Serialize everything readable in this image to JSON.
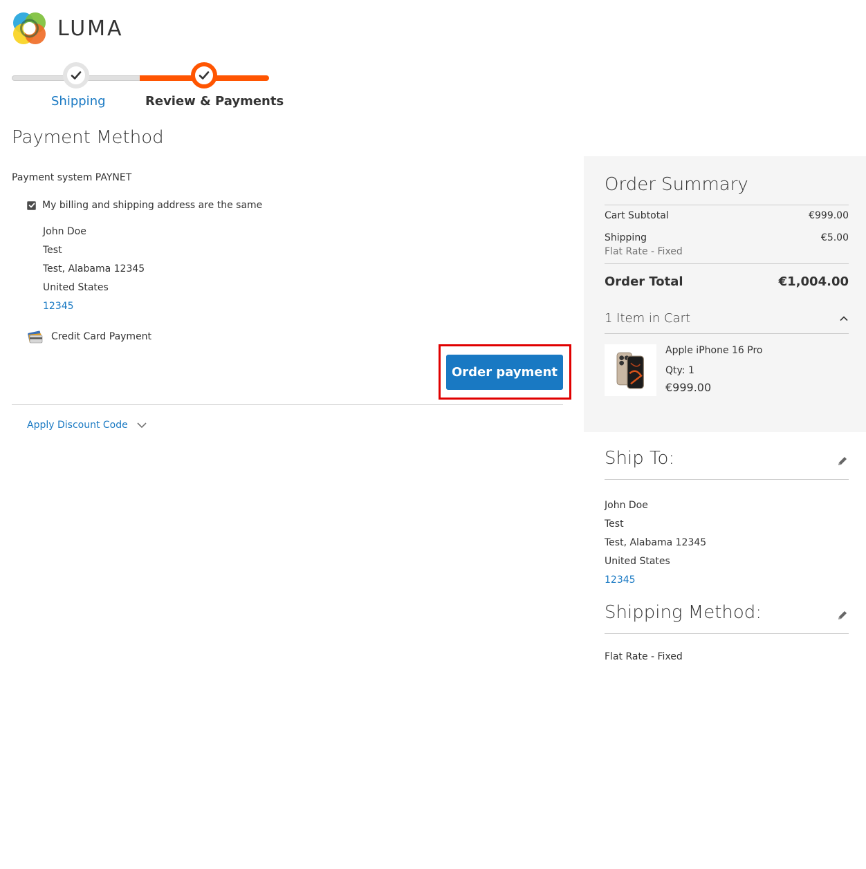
{
  "brand": {
    "name": "LUMA"
  },
  "progress": {
    "steps": [
      {
        "label": "Shipping",
        "state": "complete"
      },
      {
        "label": "Review & Payments",
        "state": "active"
      }
    ]
  },
  "payment": {
    "title": "Payment Method",
    "system_label": "Payment system PAYNET",
    "billing_same_label": "My billing and shipping address are the same",
    "billing_same_checked": true,
    "billing_address": {
      "name": "John Doe",
      "street": "Test",
      "city_line": "Test, Alabama 12345",
      "country": "United States",
      "phone": "12345"
    },
    "method_label": "Credit Card Payment",
    "order_button": "Order payment",
    "discount_label": "Apply Discount Code"
  },
  "summary": {
    "title": "Order Summary",
    "cart_subtotal_label": "Cart Subtotal",
    "cart_subtotal_value": "€999.00",
    "shipping_label": "Shipping",
    "shipping_value": "€5.00",
    "shipping_method": "Flat Rate - Fixed",
    "order_total_label": "Order Total",
    "order_total_value": "€1,004.00",
    "items_label": "1 Item in Cart",
    "items": [
      {
        "name": "Apple iPhone 16 Pro",
        "qty": "Qty: 1",
        "price": "€999.00"
      }
    ]
  },
  "ship_to": {
    "title": "Ship To:",
    "name": "John Doe",
    "street": "Test",
    "city_line": "Test, Alabama 12345",
    "country": "United States",
    "phone": "12345"
  },
  "shipping_method": {
    "title": "Shipping Method:",
    "value": "Flat Rate - Fixed"
  },
  "colors": {
    "accent": "#1979c3",
    "progress_active": "#ff5501",
    "highlight_frame": "#e00000"
  }
}
